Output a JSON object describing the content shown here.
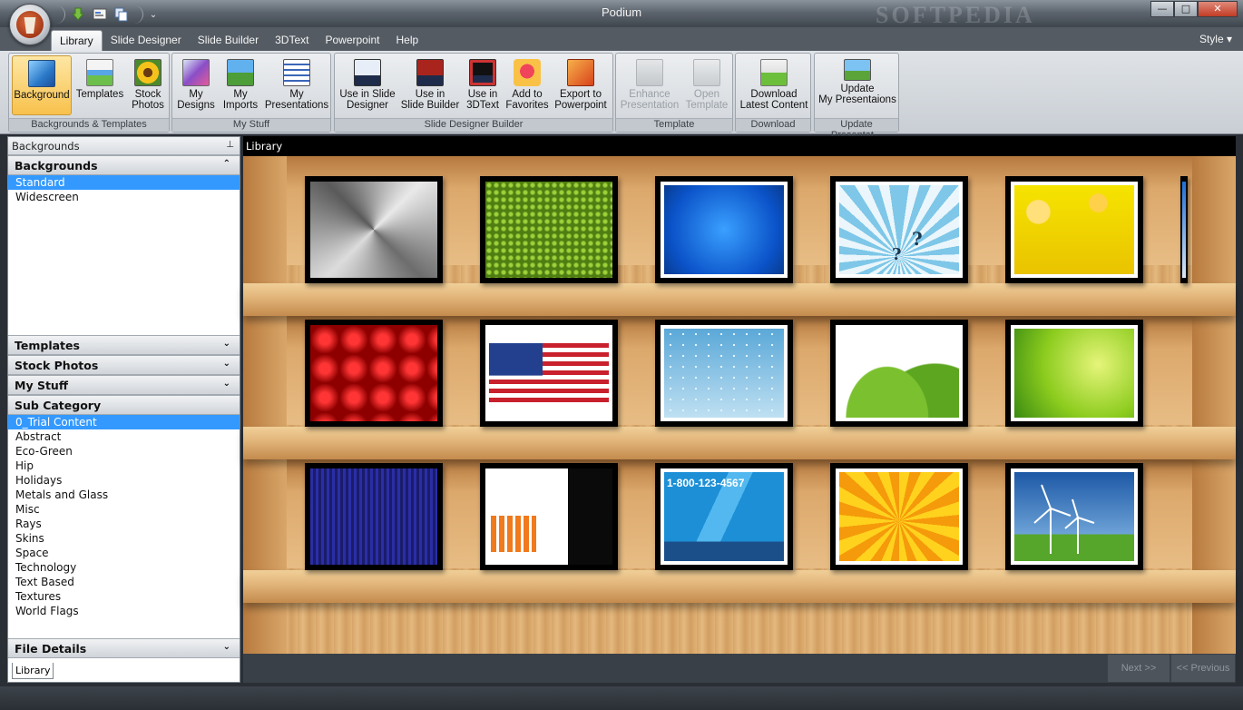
{
  "window": {
    "title": "Podium",
    "watermark": "SOFTPEDIA"
  },
  "quick_access": {
    "icons": [
      "download-icon",
      "presentation-icon",
      "copy-icon"
    ],
    "more": "⌄"
  },
  "window_controls": {
    "minimize": "—",
    "maximize": "□",
    "close": "✕"
  },
  "menu": {
    "tabs": [
      "Library",
      "Slide Designer",
      "Slide Builder",
      "3DText",
      "Powerpoint",
      "Help"
    ],
    "active_tab": "Library",
    "style_label": "Style ▾"
  },
  "ribbon": {
    "groups": [
      {
        "label": "Backgrounds & Templates",
        "buttons": [
          {
            "label": "Background",
            "active": true
          },
          {
            "label": "Templates"
          },
          {
            "label": "Stock\nPhotos"
          }
        ]
      },
      {
        "label": "My Stuff",
        "buttons": [
          {
            "label": "My\nDesigns"
          },
          {
            "label": "My\nImports"
          },
          {
            "label": "My\nPresentations"
          }
        ]
      },
      {
        "label": "Slide Designer  Builder",
        "buttons": [
          {
            "label": "Use in Slide\nDesigner"
          },
          {
            "label": "Use in\nSlide Builder"
          },
          {
            "label": "Use in\n3DText"
          },
          {
            "label": "Add to\nFavorites"
          },
          {
            "label": "Export to\nPowerpoint"
          }
        ]
      },
      {
        "label": "Template",
        "buttons": [
          {
            "label": "Enhance\nPresentation",
            "disabled": true
          },
          {
            "label": "Open\nTemplate",
            "disabled": true
          }
        ]
      },
      {
        "label": "Download",
        "buttons": [
          {
            "label": "Download\nLatest Content"
          }
        ]
      },
      {
        "label": "Update Presentat...",
        "buttons": [
          {
            "label": "Update\nMy Presentaions"
          }
        ]
      }
    ]
  },
  "left_panel": {
    "header": "Backgrounds",
    "pin": "⊥",
    "backgrounds": {
      "title": "Backgrounds",
      "items": [
        "Standard",
        "Widescreen"
      ],
      "selected": "Standard"
    },
    "sections": [
      "Templates",
      "Stock Photos",
      "My Stuff"
    ],
    "sub_category": {
      "title": "Sub Category",
      "items": [
        "0_Trial Content",
        "Abstract",
        "Eco-Green",
        "Hip",
        "Holidays",
        "Metals and Glass",
        "Misc",
        "Rays",
        "Skins",
        "Space",
        "Technology",
        "Text Based",
        "Textures",
        "World Flags"
      ],
      "selected": "0_Trial Content"
    },
    "file_details": "File Details",
    "bottom_tab": "Library"
  },
  "library": {
    "header": "Library",
    "thumbnails": [
      "Brushed metal",
      "Green hexagons",
      "Blue bubbles",
      "Blue rays with question marks",
      "Yellow bokeh",
      "Red quilted",
      "American flag",
      "Water droplets",
      "Green hills with flowers",
      "Green stars",
      "Blue sound waves",
      "Abstract tech",
      "1-800-123-4567",
      "Yellow sunburst",
      "Green energy wind turbines"
    ],
    "ad_text": "1-800-123-4567",
    "next": "Next >>",
    "previous": "<< Previous"
  }
}
